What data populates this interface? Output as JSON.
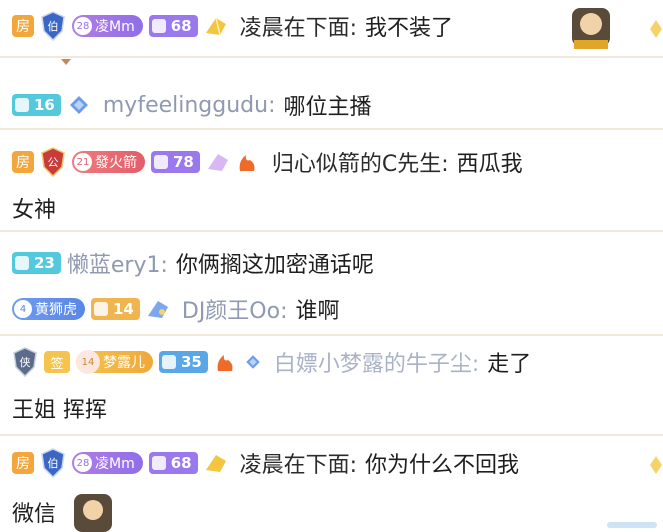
{
  "colors": {
    "fang_orange": "#f2a63b",
    "level_purple": "#a57cf0",
    "level_teal": "#54c8dd",
    "level_gold": "#f6c34c",
    "name_gray": "#8f99b1"
  },
  "messages": [
    {
      "room_badge": "房",
      "noble_badge": "伯",
      "fan_badge": {
        "level": "28",
        "name": "凌Mm"
      },
      "user_level": "68",
      "username": "凌晨在下面:",
      "text": "我不装了"
    },
    {
      "user_level": "16",
      "username": "myfeelinggudu:",
      "text": "哪位主播"
    },
    {
      "room_badge": "房",
      "noble_badge": "公",
      "fan_badge": {
        "level": "21",
        "name": "發火箭"
      },
      "user_level": "78",
      "username": "归心似箭的C先生:",
      "text_line1": "西瓜我",
      "text_line2": "女神"
    },
    {
      "user_level": "23",
      "username": "懒蓝ery1:",
      "text": "你俩搁这加密通话呢"
    },
    {
      "fan_badge": {
        "level": "4",
        "name": "黄狮虎"
      },
      "user_level": "14",
      "username": "DJ颜王Oo:",
      "text": "谁啊"
    },
    {
      "noble_badge": "侠",
      "sign_badge": "签",
      "fan_badge": {
        "level": "14",
        "name": "梦露儿"
      },
      "user_level": "35",
      "username": "白嫖小梦露的牛子尘:",
      "text_line1": "走了",
      "text_line2": "王姐 挥挥"
    },
    {
      "room_badge": "房",
      "noble_badge": "伯",
      "fan_badge": {
        "level": "28",
        "name": "凌Mm"
      },
      "user_level": "68",
      "username": "凌晨在下面:",
      "text_line1": "你为什么不回我",
      "text_line2": "微信"
    }
  ],
  "icons": {
    "noble": "shield-icon",
    "gem": "gem-icon",
    "fire": "flame-icon",
    "diamond": "diamond-icon",
    "avatar": "robot-avatar"
  }
}
